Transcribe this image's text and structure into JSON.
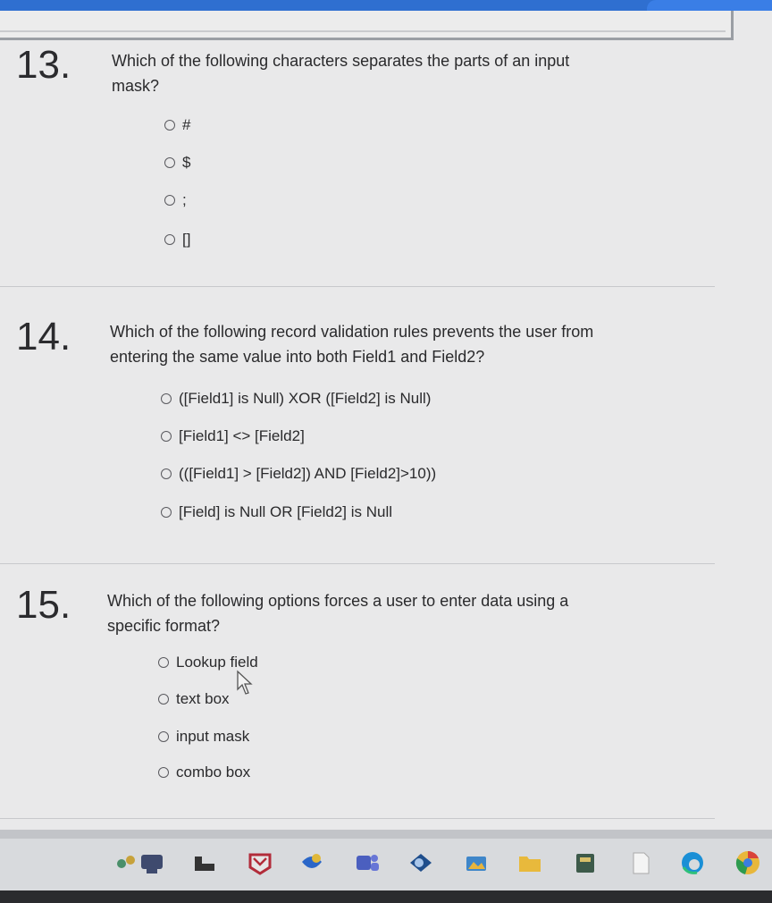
{
  "questions": [
    {
      "number": "13.",
      "text": "Which of the following characters separates the parts of an input mask?",
      "options": [
        "#",
        "$",
        ";",
        "[]"
      ]
    },
    {
      "number": "14.",
      "text": "Which of the following record validation rules prevents the user from entering the same value into both Field1 and Field2?",
      "options": [
        "([Field1] is Null) XOR ([Field2] is Null)",
        "[Field1] <> [Field2]",
        "(([Field1] > [Field2]) AND [Field2]>10))",
        "[Field] is Null OR [Field2] is Null"
      ]
    },
    {
      "number": "15.",
      "text": "Which of the following options forces a user to enter data using a specific format?",
      "options": [
        "Lookup field",
        "text box",
        "input mask",
        "combo box"
      ]
    }
  ],
  "taskbar": {
    "icons": [
      "widgets-icon",
      "file-explorer-icon",
      "mail-icon",
      "store-icon",
      "teams-icon",
      "camera-icon",
      "photos-icon",
      "folder-icon",
      "calculator-icon",
      "document-icon",
      "edge-icon",
      "chrome-icon"
    ]
  }
}
